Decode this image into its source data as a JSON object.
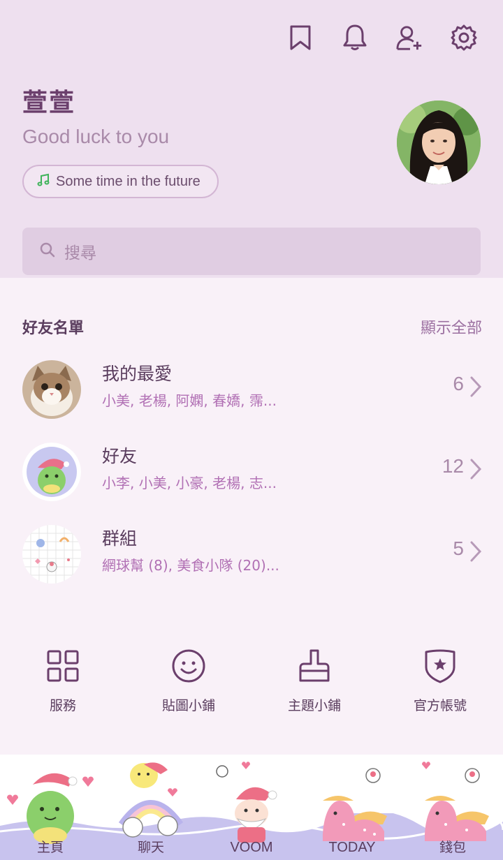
{
  "header": {
    "icons": [
      "bookmark-icon",
      "bell-icon",
      "add-friend-icon",
      "settings-icon"
    ]
  },
  "profile": {
    "name": "萱萱",
    "status": "Good luck to you",
    "music": "Some time in the future"
  },
  "search": {
    "placeholder": "搜尋"
  },
  "friends_section": {
    "title": "好友名單",
    "show_all": "顯示全部",
    "rows": [
      {
        "title": "我的最愛",
        "subtitle": "小美, 老楊, 阿嫻, 春嬌, 霈...",
        "count": "6",
        "thumb": "cat-photo"
      },
      {
        "title": "好友",
        "subtitle": "小李, 小美, 小豪, 老楊, 志...",
        "count": "12",
        "thumb": "dino-sticker"
      },
      {
        "title": "群組",
        "subtitle": "網球幫 (8), 美食小隊 (20)...",
        "count": "5",
        "thumb": "grid-stickers"
      }
    ]
  },
  "tools": [
    {
      "label": "服務",
      "icon": "grid-icon"
    },
    {
      "label": "貼圖小鋪",
      "icon": "smile-icon"
    },
    {
      "label": "主題小鋪",
      "icon": "brush-icon"
    },
    {
      "label": "官方帳號",
      "icon": "shield-star-icon"
    }
  ],
  "tabs": [
    {
      "label": "主頁"
    },
    {
      "label": "聊天"
    },
    {
      "label": "VOOM"
    },
    {
      "label": "TODAY"
    },
    {
      "label": "錢包"
    }
  ],
  "colors": {
    "accent": "#9b6fa0",
    "header_bg": "#eee0ef",
    "body_bg": "#f9f1f8",
    "subtitle": "#b170b4"
  }
}
